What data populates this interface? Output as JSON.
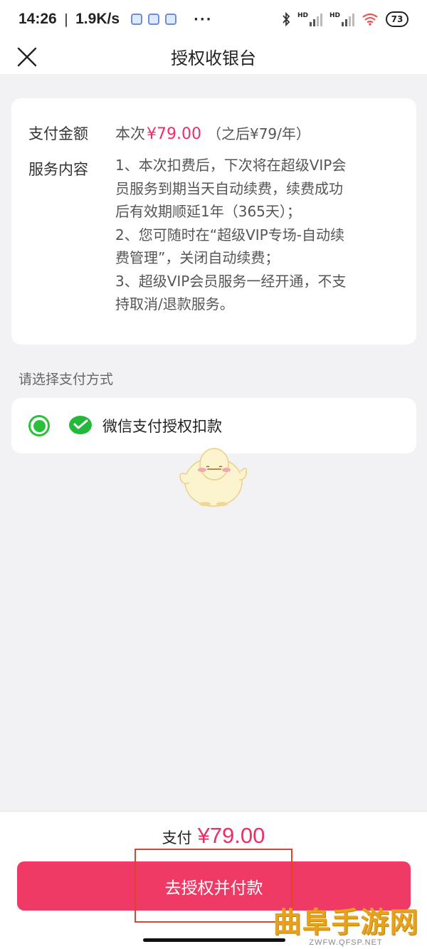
{
  "status_bar": {
    "time": "14:26",
    "speed": "1.9K/s",
    "more": "···",
    "signal1_label": "HD",
    "signal2_label": "HD",
    "battery": "73"
  },
  "header": {
    "title": "授权收银台",
    "close_icon": "close-icon"
  },
  "info_card": {
    "amount_label": "支付金额",
    "amount_prefix": "本次",
    "amount_value": "¥79.00",
    "amount_note": "（之后¥79/年）",
    "service_label": "服务内容",
    "service_lines": [
      "1、本次扣费后，下次将在超级VIP会",
      "员服务到期当天自动续费，续费成功",
      "后有效期顺延1年（365天）；",
      "2、您可随时在“超级VIP专场-自动续",
      "费管理”，关闭自动续费；",
      "3、超级VIP会员服务一经开通，不支",
      "持取消/退款服务。"
    ]
  },
  "payment_section": {
    "label": "请选择支付方式",
    "method_label": "微信支付授权扣款",
    "selected": true,
    "icon": "wechat-pay-icon"
  },
  "footer": {
    "total_label": "支付",
    "total_amount": "¥79.00",
    "button_label": "去授权并付款"
  },
  "watermark": {
    "main": "曲阜手游网",
    "sub": "ZWFW.QFSP.NET"
  },
  "colors": {
    "accent": "#ef3a66",
    "price": "#ee2e64",
    "wechat_green": "#2bbf3c",
    "highlight": "#e2422a"
  }
}
